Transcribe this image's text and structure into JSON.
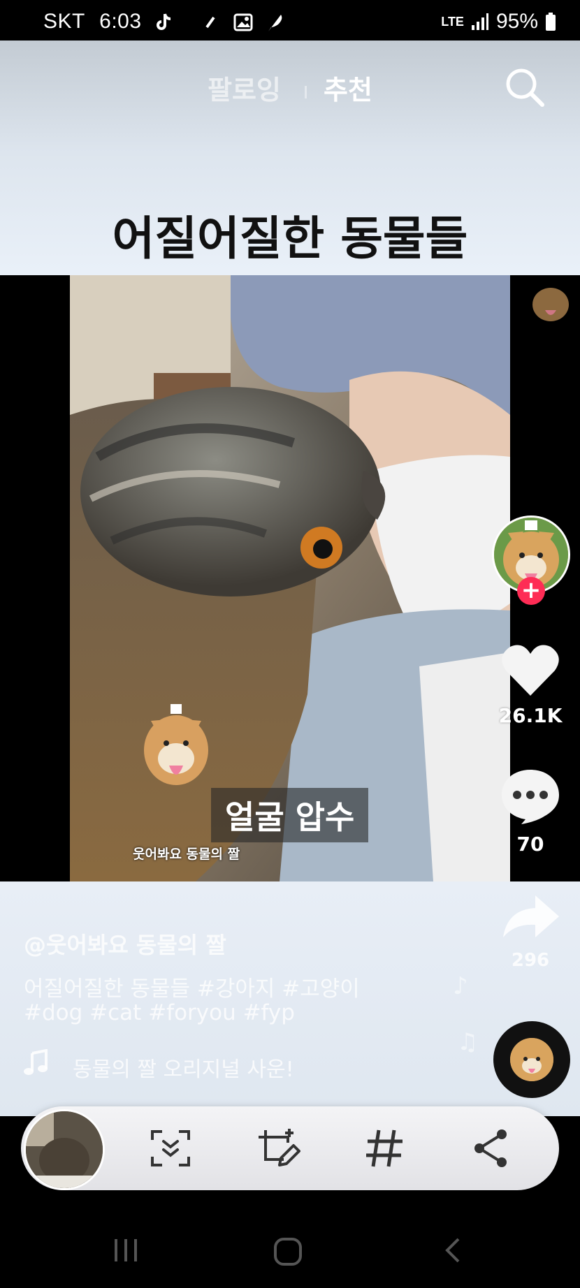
{
  "status_bar": {
    "carrier": "SKT",
    "time": "6:03",
    "network": "LTE",
    "battery": "95%"
  },
  "top_nav": {
    "tab_following": "팔로잉",
    "tab_recommended": "추천"
  },
  "video": {
    "title": "어질어질한 동물들",
    "caption": "얼굴 압수",
    "watermark": "웃어봐요 동물의 짤"
  },
  "actions": {
    "like_count": "26.1K",
    "comment_count": "70",
    "share_count": "296"
  },
  "post": {
    "username": "@웃어봐요 동물의 짤",
    "description_line1": "어질어질한 동물들 #강아지 #고양이",
    "description_line2": "#dog #cat #foryou #fyp",
    "sound": "동물의 짤   오리지널 사운!"
  },
  "colors": {
    "accent": "#fe2c55"
  }
}
